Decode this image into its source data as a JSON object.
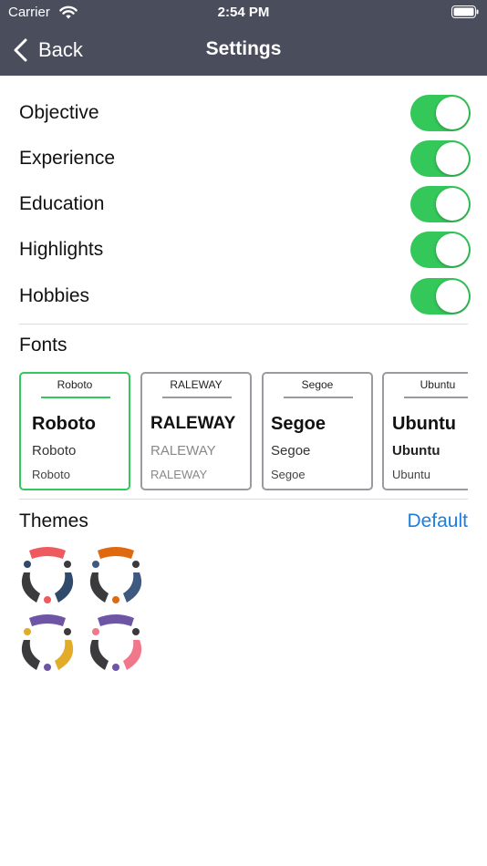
{
  "status_bar": {
    "carrier": "Carrier",
    "time": "2:54 PM"
  },
  "nav": {
    "back_label": "Back",
    "title": "Settings"
  },
  "sections_toggles": [
    {
      "label": "Objective",
      "on": true
    },
    {
      "label": "Experience",
      "on": true
    },
    {
      "label": "Education",
      "on": true
    },
    {
      "label": "Highlights",
      "on": true
    },
    {
      "label": "Hobbies",
      "on": true
    }
  ],
  "fonts": {
    "title": "Fonts",
    "cards": [
      {
        "header": "Roboto",
        "large": "Roboto",
        "medium": "Roboto",
        "small": "Roboto",
        "selected": true
      },
      {
        "header": "RALEWAY",
        "large": "RALEWAY",
        "medium": "RALEWAY",
        "small": "RALEWAY",
        "selected": false
      },
      {
        "header": "Segoe",
        "large": "Segoe",
        "medium": "Segoe",
        "small": "Segoe",
        "selected": false
      },
      {
        "header": "Ubuntu",
        "large": "Ubuntu",
        "medium": "Ubuntu",
        "small": "Ubuntu",
        "selected": false
      }
    ]
  },
  "themes": {
    "title": "Themes",
    "default_label": "Default",
    "items": [
      {
        "name": "theme-red-navy",
        "top": "#ef5a5f",
        "left": "#3b3b3d",
        "right": "#2f4a6b",
        "dots": [
          "#2f4a6b",
          "#3b3b3d",
          "#ef5a5f"
        ]
      },
      {
        "name": "theme-orange-blue",
        "top": "#e0680f",
        "left": "#3b3b3d",
        "right": "#3f5a80",
        "dots": [
          "#3f5a80",
          "#3b3b3d",
          "#e0680f"
        ]
      },
      {
        "name": "theme-purple-gold",
        "top": "#6e55a6",
        "left": "#3b3b3d",
        "right": "#e2ac28",
        "dots": [
          "#e2ac28",
          "#3b3b3d",
          "#6e55a6"
        ]
      },
      {
        "name": "theme-purple-pink",
        "top": "#6e55a6",
        "left": "#3b3b3d",
        "right": "#f1788a",
        "dots": [
          "#f1788a",
          "#3b3b3d",
          "#6e55a6"
        ]
      }
    ]
  },
  "colors": {
    "nav_bg": "#4a4d5c",
    "toggle_on": "#34c759",
    "link": "#1a7fe0",
    "selected_border": "#34c759"
  }
}
